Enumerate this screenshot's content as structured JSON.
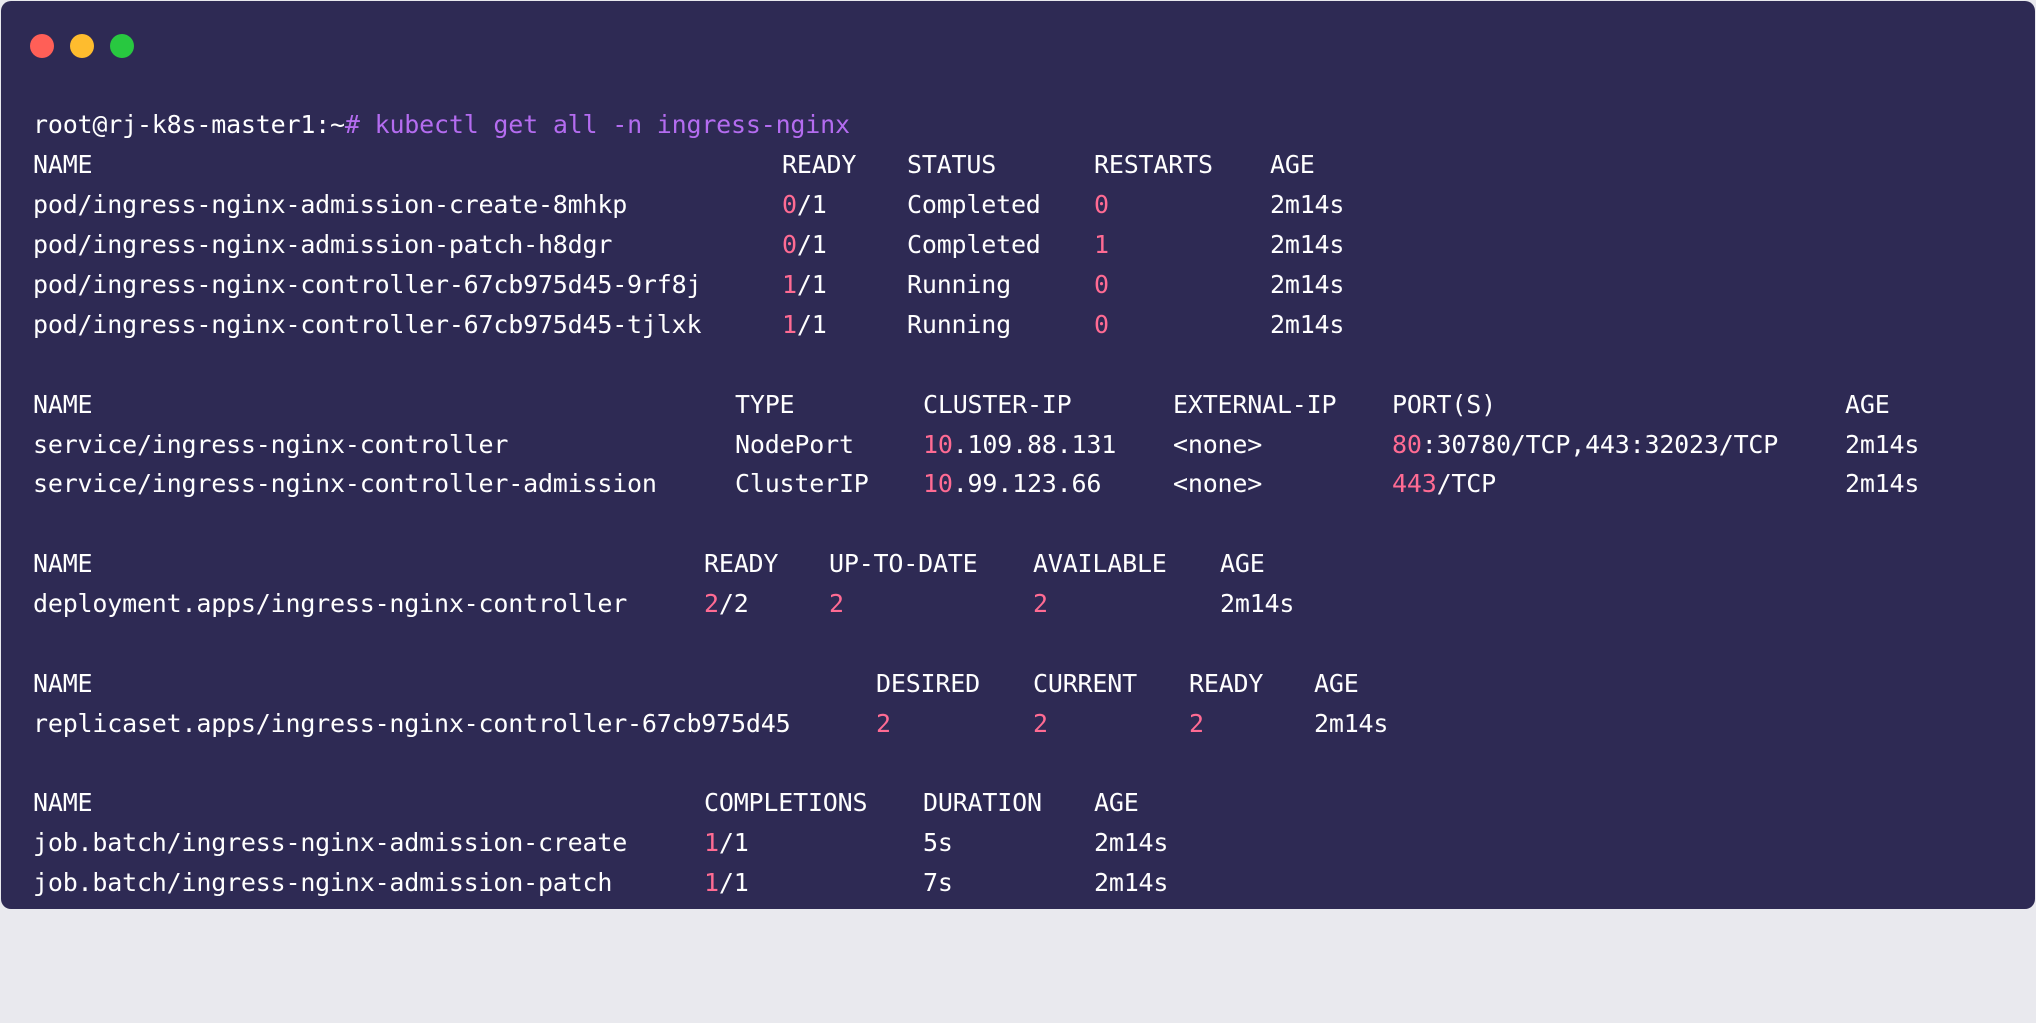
{
  "window": {
    "controls": [
      "close",
      "minimize",
      "maximize"
    ],
    "colors": {
      "close": "#ff5f57",
      "minimize": "#febc2e",
      "maximize": "#28c840",
      "background": "#2e2a54",
      "highlight": "#ff6b93",
      "command": "#b46cf0"
    }
  },
  "prompt": {
    "user_host": "root@rj-k8s-master1:~",
    "symbol": "#",
    "command": " kubectl get all -n ingress-nginx"
  },
  "pods": {
    "headers": [
      "NAME",
      "READY",
      "STATUS",
      "RESTARTS",
      "AGE"
    ],
    "rows": [
      {
        "name": "pod/ingress-nginx-admission-create-8mhkp",
        "ready_hl": "0",
        "ready_rest": "/1",
        "status": "Completed",
        "restarts": "0",
        "age": "2m14s"
      },
      {
        "name": "pod/ingress-nginx-admission-patch-h8dgr",
        "ready_hl": "0",
        "ready_rest": "/1",
        "status": "Completed",
        "restarts": "1",
        "age": "2m14s"
      },
      {
        "name": "pod/ingress-nginx-controller-67cb975d45-9rf8j",
        "ready_hl": "1",
        "ready_rest": "/1",
        "status": "Running",
        "restarts": "0",
        "age": "2m14s"
      },
      {
        "name": "pod/ingress-nginx-controller-67cb975d45-tjlxk",
        "ready_hl": "1",
        "ready_rest": "/1",
        "status": "Running",
        "restarts": "0",
        "age": "2m14s"
      }
    ]
  },
  "services": {
    "headers": [
      "NAME",
      "TYPE",
      "CLUSTER-IP",
      "EXTERNAL-IP",
      "PORT(S)",
      "AGE"
    ],
    "rows": [
      {
        "name": "service/ingress-nginx-controller",
        "type": "NodePort",
        "ip_hl": "10",
        "ip_rest": ".109.88.131",
        "external": "<none>",
        "port_hl": "80",
        "port_rest": ":30780/TCP,443:32023/TCP",
        "age": "2m14s"
      },
      {
        "name": "service/ingress-nginx-controller-admission",
        "type": "ClusterIP",
        "ip_hl": "10",
        "ip_rest": ".99.123.66",
        "external": "<none>",
        "port_hl": "443",
        "port_rest": "/TCP",
        "age": "2m14s"
      }
    ]
  },
  "deployments": {
    "headers": [
      "NAME",
      "READY",
      "UP-TO-DATE",
      "AVAILABLE",
      "AGE"
    ],
    "rows": [
      {
        "name": "deployment.apps/ingress-nginx-controller",
        "ready_hl": "2",
        "ready_rest": "/2",
        "uptodate": "2",
        "available": "2",
        "age": "2m14s"
      }
    ]
  },
  "replicasets": {
    "headers": [
      "NAME",
      "DESIRED",
      "CURRENT",
      "READY",
      "AGE"
    ],
    "rows": [
      {
        "name": "replicaset.apps/ingress-nginx-controller-67cb975d45",
        "desired": "2",
        "current": "2",
        "ready": "2",
        "age": "2m14s"
      }
    ]
  },
  "jobs": {
    "headers": [
      "NAME",
      "COMPLETIONS",
      "DURATION",
      "AGE"
    ],
    "rows": [
      {
        "name": "job.batch/ingress-nginx-admission-create",
        "comp_hl": "1",
        "comp_rest": "/1",
        "duration": "5s",
        "age": "2m14s"
      },
      {
        "name": "job.batch/ingress-nginx-admission-patch",
        "comp_hl": "1",
        "comp_rest": "/1",
        "duration": "7s",
        "age": "2m14s"
      }
    ]
  }
}
